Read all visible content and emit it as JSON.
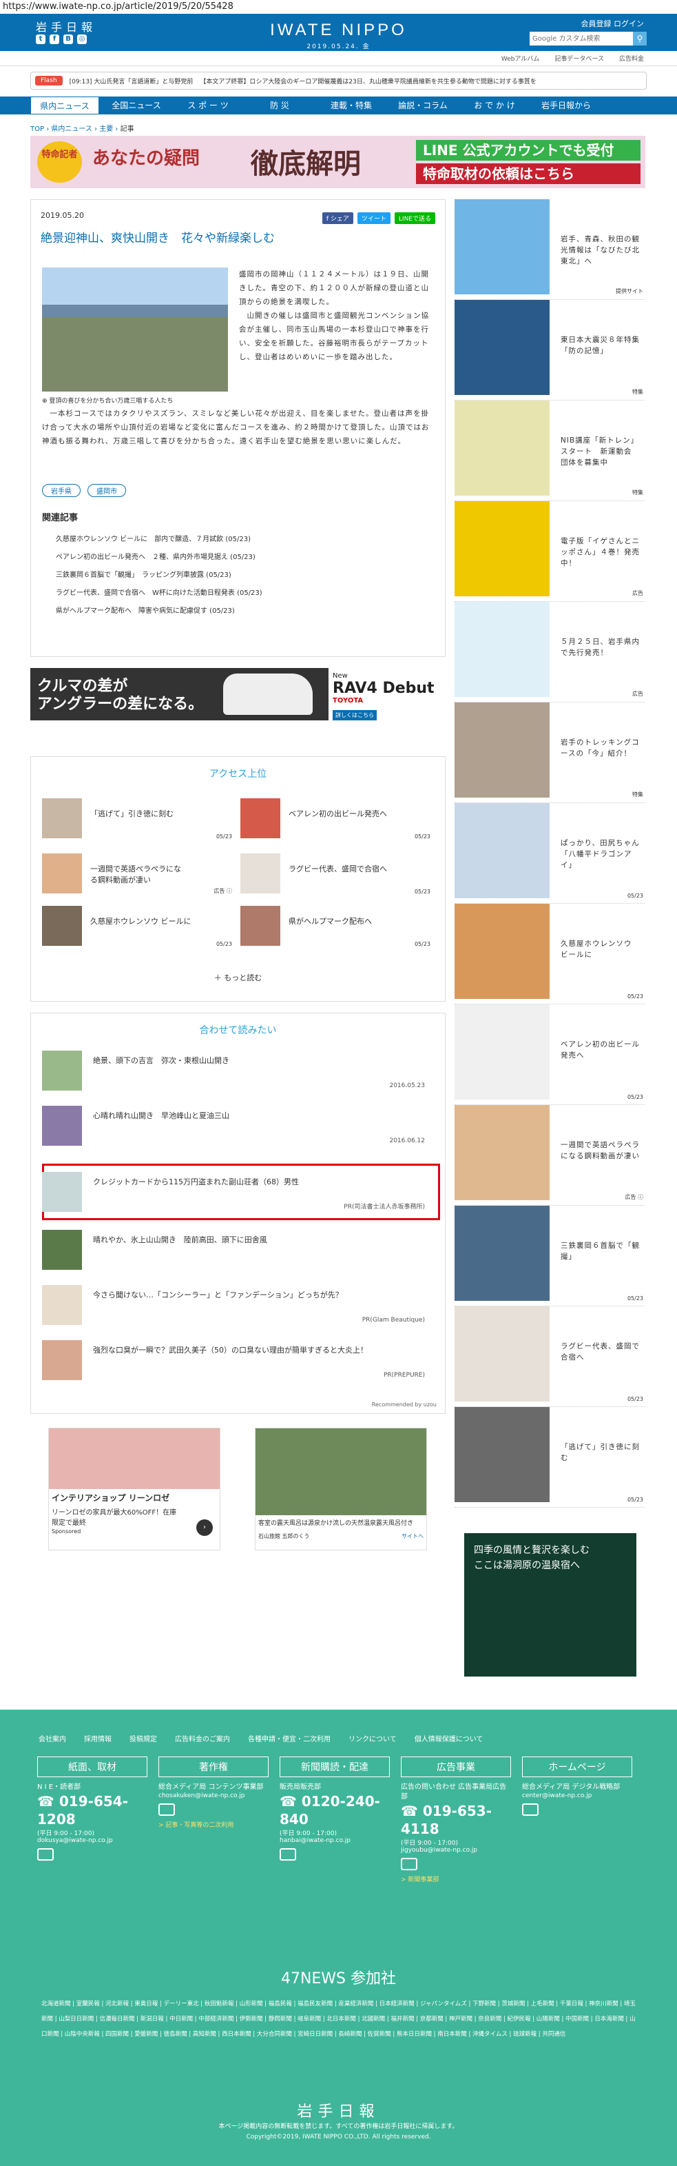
{
  "url": "https://www.iwate-np.co.jp/article/2019/5/20/55428",
  "header": {
    "logo_small": "岩手日報",
    "brand": "IWATE NIPPO",
    "date": "2019.05.24. 金",
    "account": "会員登録  ログイン",
    "search_placeholder": "Google カスタム検索",
    "social": [
      "t",
      "f",
      "B",
      "◎"
    ]
  },
  "subnav": [
    "Webアルバム",
    "記事データベース",
    "広告料金"
  ],
  "flash": {
    "tag": "Flash",
    "items": [
      "[09:13] 大山氏発言「言語道断」と与野党前",
      "【本文アプ終罪】ロシア大陸会のギーロア開催蔑義は23日、丸山穂衆平院議員維新を共生参る動物で問題に対する事質を"
    ]
  },
  "nav": [
    "県内ニュース",
    "全国ニュース",
    "ス ポ ー ツ",
    "防  災",
    "連載・特集",
    "論説・コラム",
    "お で か け",
    "岩手日報から"
  ],
  "breadcrumb": {
    "items": [
      "TOP",
      "県内ニュース",
      "主要"
    ],
    "current": "記事"
  },
  "banner": {
    "badge": "特命記者",
    "l2": "あなたの疑問",
    "l3": "徹底解明",
    "r1": "LINE 公式アカウントでも受付",
    "r2": "特命取材の依頼はこちら"
  },
  "article": {
    "date": "2019.05.20",
    "share": [
      "f シェア",
      "ツイート",
      "LINEで送る"
    ],
    "title": "絶景迎神山、爽快山開き　花々や新緑楽しむ",
    "caption": "登頂の喜びを分かち合い万歳三唱する人たち",
    "body1": "盛岡市の岡神山（１１２４メートル）は１９日、山開きした。青空の下、約１２００人が新緑の登山道と山頂からの絶景を満喫した。\n　山開きの催しは盛岡市と盛岡観光コンベンション協会が主催し、同市玉山馬場の一本杉登山口で神事を行い、安全を祈願した。谷藤裕明市長らがテープカットし、登山者はめいめいに一歩を踏み出した。",
    "body2": "　一本杉コースではカタクリやスズラン、スミレなど美しい花々が出迎え、目を楽しませた。登山者は声を掛け合って大水の場所や山頂付近の岩場など変化に富んだコースを進み、約２時間かけて登頂した。山頂ではお神酒も振る舞われ、万歳三唱して喜びを分かち合った。遠く岩手山を望む絶景を思い思いに楽しんだ。",
    "tags": [
      "岩手県",
      "盛岡市"
    ],
    "related_h": "関連記事",
    "related": [
      "久慈屋ホウレンソウ ビールに　部内で醸造、７月試飲 (05/23)",
      "ペアレン初の出ビール発売へ　２種、県内外市場見据え (05/23)",
      "三鉄裏岡６首脳で「観撮」　ラッピング列車披露 (05/23)",
      "ラグビー代表、盛岡で合宿へ　W杯に向けた活動日程発表 (05/23)",
      "県がヘルプマーク配布へ　障害や病気に配慮促す (05/23)"
    ]
  },
  "ad_rav4": {
    "line1": "クルマの差が",
    "line2": "アングラーの差になる。",
    "new": "New",
    "model": "RAV4 Debut",
    "brand": "TOYOTA",
    "cta": "詳しくはこちら"
  },
  "ranking": {
    "title": "アクセス上位",
    "items": [
      {
        "text": "「逃げて」引き徳に刻む",
        "date": "05/23"
      },
      {
        "text": "ベアレン初の出ビール発売へ",
        "date": "05/23"
      },
      {
        "text": "一週間で英語ペラペラになる鋼料動画が凄い",
        "date": "広告 ⓘ"
      },
      {
        "text": "ラグビー代表、盛岡で合宿へ",
        "date": "05/23"
      },
      {
        "text": "久慈屋ホウレンソウ ビールに",
        "date": "05/23"
      },
      {
        "text": "県がヘルプマーク配布へ",
        "date": "05/23"
      }
    ],
    "more": "もっと読む"
  },
  "reco": {
    "title": "合わせて読みたい",
    "items": [
      {
        "text": "絶景、頭下の吉言　弥次・東根山山開き",
        "date": "2016.05.23"
      },
      {
        "text": "心晴れ晴れ山開き　早池峰山と夏油三山",
        "date": "2016.06.12"
      },
      {
        "text": "クレジットカードから115万円盗まれた副山荘者（68）男性",
        "date": "PR(司法書士法人赤坂事務所)"
      },
      {
        "text": "晴れやか、氷上山山開き　陸前高田、頭下に田舎風",
        "date": ""
      },
      {
        "text": "今さら聞けない…「コンシーラー」と「ファンデーション」どっちが先？",
        "date": "PR(Glam Beautique)"
      },
      {
        "text": "強烈な口臭が一瞬で？武田久美子（50）の口臭ない理由が簡単すぎると大炎上！",
        "date": "PR(PREPURE)"
      }
    ],
    "footer": "Recommended by uzou"
  },
  "ad_interior": {
    "title": "インテリアショップ リーンロゼ",
    "text": "リーンロゼの家具が最大60%OFF！在庫限定で最終",
    "sponsor": "Sponsored"
  },
  "ad_onsen": {
    "text": "客室の露天風呂は源泉かけ流しの天然温泉露天風呂付き",
    "link": "サイトへ",
    "sponsor": "石山旅館 五郎のくう"
  },
  "side": [
    {
      "text": "岩手、青森、秋田の観光情報は「なびたび北東北」へ",
      "cat": "提供サイト"
    },
    {
      "text": "東日本大震災８年特集「防の記憶」",
      "cat": "特集"
    },
    {
      "text": "NIB講座「新トレン」スタート　新運動会　団体を募集中",
      "cat": "特集"
    },
    {
      "text": "電子版「イゲさんとニッポさん」４巻！発売中！",
      "cat": "広告"
    },
    {
      "text": "５月２５日、岩手県内で先行発売！",
      "cat": "広告"
    },
    {
      "text": "岩手のトレッキングコースの「今」紹介！",
      "cat": "特集"
    },
    {
      "text": "ぱっかり、田尻ちゃん「八幡平ドラゴンアイ」",
      "cat": "05/23"
    },
    {
      "text": "久慈屋ホウレンソウ ビールに",
      "cat": "05/23"
    },
    {
      "text": "ベアレン初の出ビール発売へ",
      "cat": "05/23"
    },
    {
      "text": "一週間で英語ペラペラになる鋼料動画が凄い",
      "cat": "広告 ⓘ"
    },
    {
      "text": "三鉄裏岡６首脳で「観撮」",
      "cat": "05/23"
    },
    {
      "text": "ラグビー代表、盛岡で合宿へ",
      "cat": "05/23"
    },
    {
      "text": "「逃げて」引き徳に刻む",
      "cat": "05/23"
    }
  ],
  "side_ad": "四季の風情と贅沢を楽しむ\nここは湯洞原の温泉宿へ",
  "footer": {
    "links": [
      "会社案内",
      "採用情報",
      "投稿規定",
      "広告料金のご案内",
      "各種申請・便宜・二次利用",
      "リンクについて",
      "個人情報保護について"
    ],
    "cols": [
      {
        "h": "紙面、取材",
        "c": "N I E・読者部",
        "tel": "019-654-1208",
        "sm": "(平日 9:00 - 17:00)",
        "mail": "dokusya@iwate-np.co.jp",
        "y": ""
      },
      {
        "h": "著作権",
        "c": "総合メディア局 コンテンツ事業部",
        "tel": "",
        "sm": "chosakuken@iwate-np.co.jp",
        "mail": "",
        "y": "> 記事・写真等の二次利用"
      },
      {
        "h": "新聞購読・配達",
        "c": "販売局販売部",
        "tel": "0120-240-840",
        "sm": "(平日 9:00 - 17:00)",
        "mail": "hanbai@iwate-np.co.jp",
        "y": ""
      },
      {
        "h": "広告事業",
        "c": "広告の問い合わせ 広告事業局広告部",
        "tel": "019-653-4118",
        "sm": "(平日 9:00 - 17:00)",
        "mail": "jigyoubu@iwate-np.co.jp",
        "y": "> 新聞事業部"
      },
      {
        "h": "ホームページ",
        "c": "総合メディア局 デジタル戦略部",
        "tel": "",
        "sm": "center@iwate-np.co.jp",
        "mail": "",
        "y": ""
      }
    ],
    "news47": "47NEWS 参加社",
    "papers": "北海道新聞 | 室蘭民報 | 河北新報 | 東奥日報 | デーリー東北 | 秋田魁新報 | 山形新聞 | 福島民報 | 福島民友新聞 | 産業経済新聞 | 日本経済新聞 | ジャパンタイムズ | 下野新聞 | 茨城新聞 | 上毛新聞 | 千葉日報 | 神奈川新聞 | 埼玉新聞 | 山梨日日新聞 | 信濃毎日新聞 | 新潟日報 | 中日新聞 | 中部経済新聞 | 伊勢新聞 | 静岡新聞 | 岐阜新聞 | 北日本新聞 | 北國新聞 | 福井新聞 | 京都新聞 | 神戸新聞 | 奈良新聞 | 紀伊民報 | 山陽新聞 | 中国新聞 | 日本海新聞 | 山口新聞 | 山陰中央新報 | 四国新聞 | 愛媛新聞 | 徳島新聞 | 高知新聞 | 西日本新聞 | 大分合同新聞 | 宮崎日日新聞 | 長崎新聞 | 佐賀新聞 | 熊本日日新聞 | 南日本新聞 | 沖縄タイムス | 琉球新報 | 共同通信",
    "logo": "岩手日報",
    "note": "本ページ掲載内容の無断転載を禁じます。すべての著作権は岩手日報社に帰属します。",
    "copy": "Copyright©2019, IWATE NIPPO CO.,LTD. All rights reserved."
  }
}
